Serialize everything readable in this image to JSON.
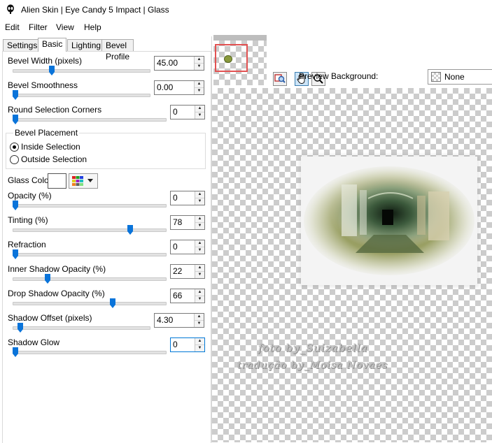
{
  "window": {
    "title": "Alien Skin | Eye Candy 5 Impact | Glass",
    "app_icon": "alien-skin-icon"
  },
  "menu": [
    "Edit",
    "Filter",
    "View",
    "Help"
  ],
  "tabs": [
    {
      "label": "Settings",
      "active": false
    },
    {
      "label": "Basic",
      "active": true
    },
    {
      "label": "Lighting",
      "active": false
    },
    {
      "label": "Bevel Profile",
      "active": false
    }
  ],
  "controls": {
    "bevel_width": {
      "label": "Bevel Width (pixels)",
      "value": "45.00",
      "slider": 0.28
    },
    "bevel_smoothness": {
      "label": "Bevel Smoothness",
      "value": "0.00",
      "slider": 0.0
    },
    "round_corners": {
      "label": "Round Selection Corners",
      "value": "0",
      "slider": 0.0
    },
    "opacity": {
      "label": "Opacity (%)",
      "value": "0",
      "slider": 0.0
    },
    "tinting": {
      "label": "Tinting (%)",
      "value": "78",
      "slider": 0.78
    },
    "refraction": {
      "label": "Refraction",
      "value": "0",
      "slider": 0.0
    },
    "inner_shadow_opacity": {
      "label": "Inner Shadow Opacity (%)",
      "value": "22",
      "slider": 0.22
    },
    "drop_shadow_opacity": {
      "label": "Drop Shadow Opacity (%)",
      "value": "66",
      "slider": 0.66
    },
    "shadow_offset": {
      "label": "Shadow Offset (pixels)",
      "value": "4.30",
      "slider": 0.04
    },
    "shadow_glow": {
      "label": "Shadow Glow",
      "value": "0",
      "slider": 0.0
    }
  },
  "bevel_placement": {
    "legend": "Bevel Placement",
    "inside": "Inside Selection",
    "outside": "Outside Selection",
    "selected": "inside"
  },
  "glass_color": {
    "label": "Glass Color",
    "swatch": "#ffffff",
    "picker_icon": "color-grid-icon",
    "dropdown_icon": "chevron-down-icon"
  },
  "preview_toolbar": {
    "tools": [
      "zoom-preview-icon",
      "hand-icon",
      "magnifier-icon"
    ],
    "active_tool": "hand-icon",
    "background_label": "Preview Background:",
    "background_value": "None"
  },
  "watermark": {
    "line1": "foto by_Suizabella",
    "line2": "tradução by_Moisa Novaes"
  }
}
